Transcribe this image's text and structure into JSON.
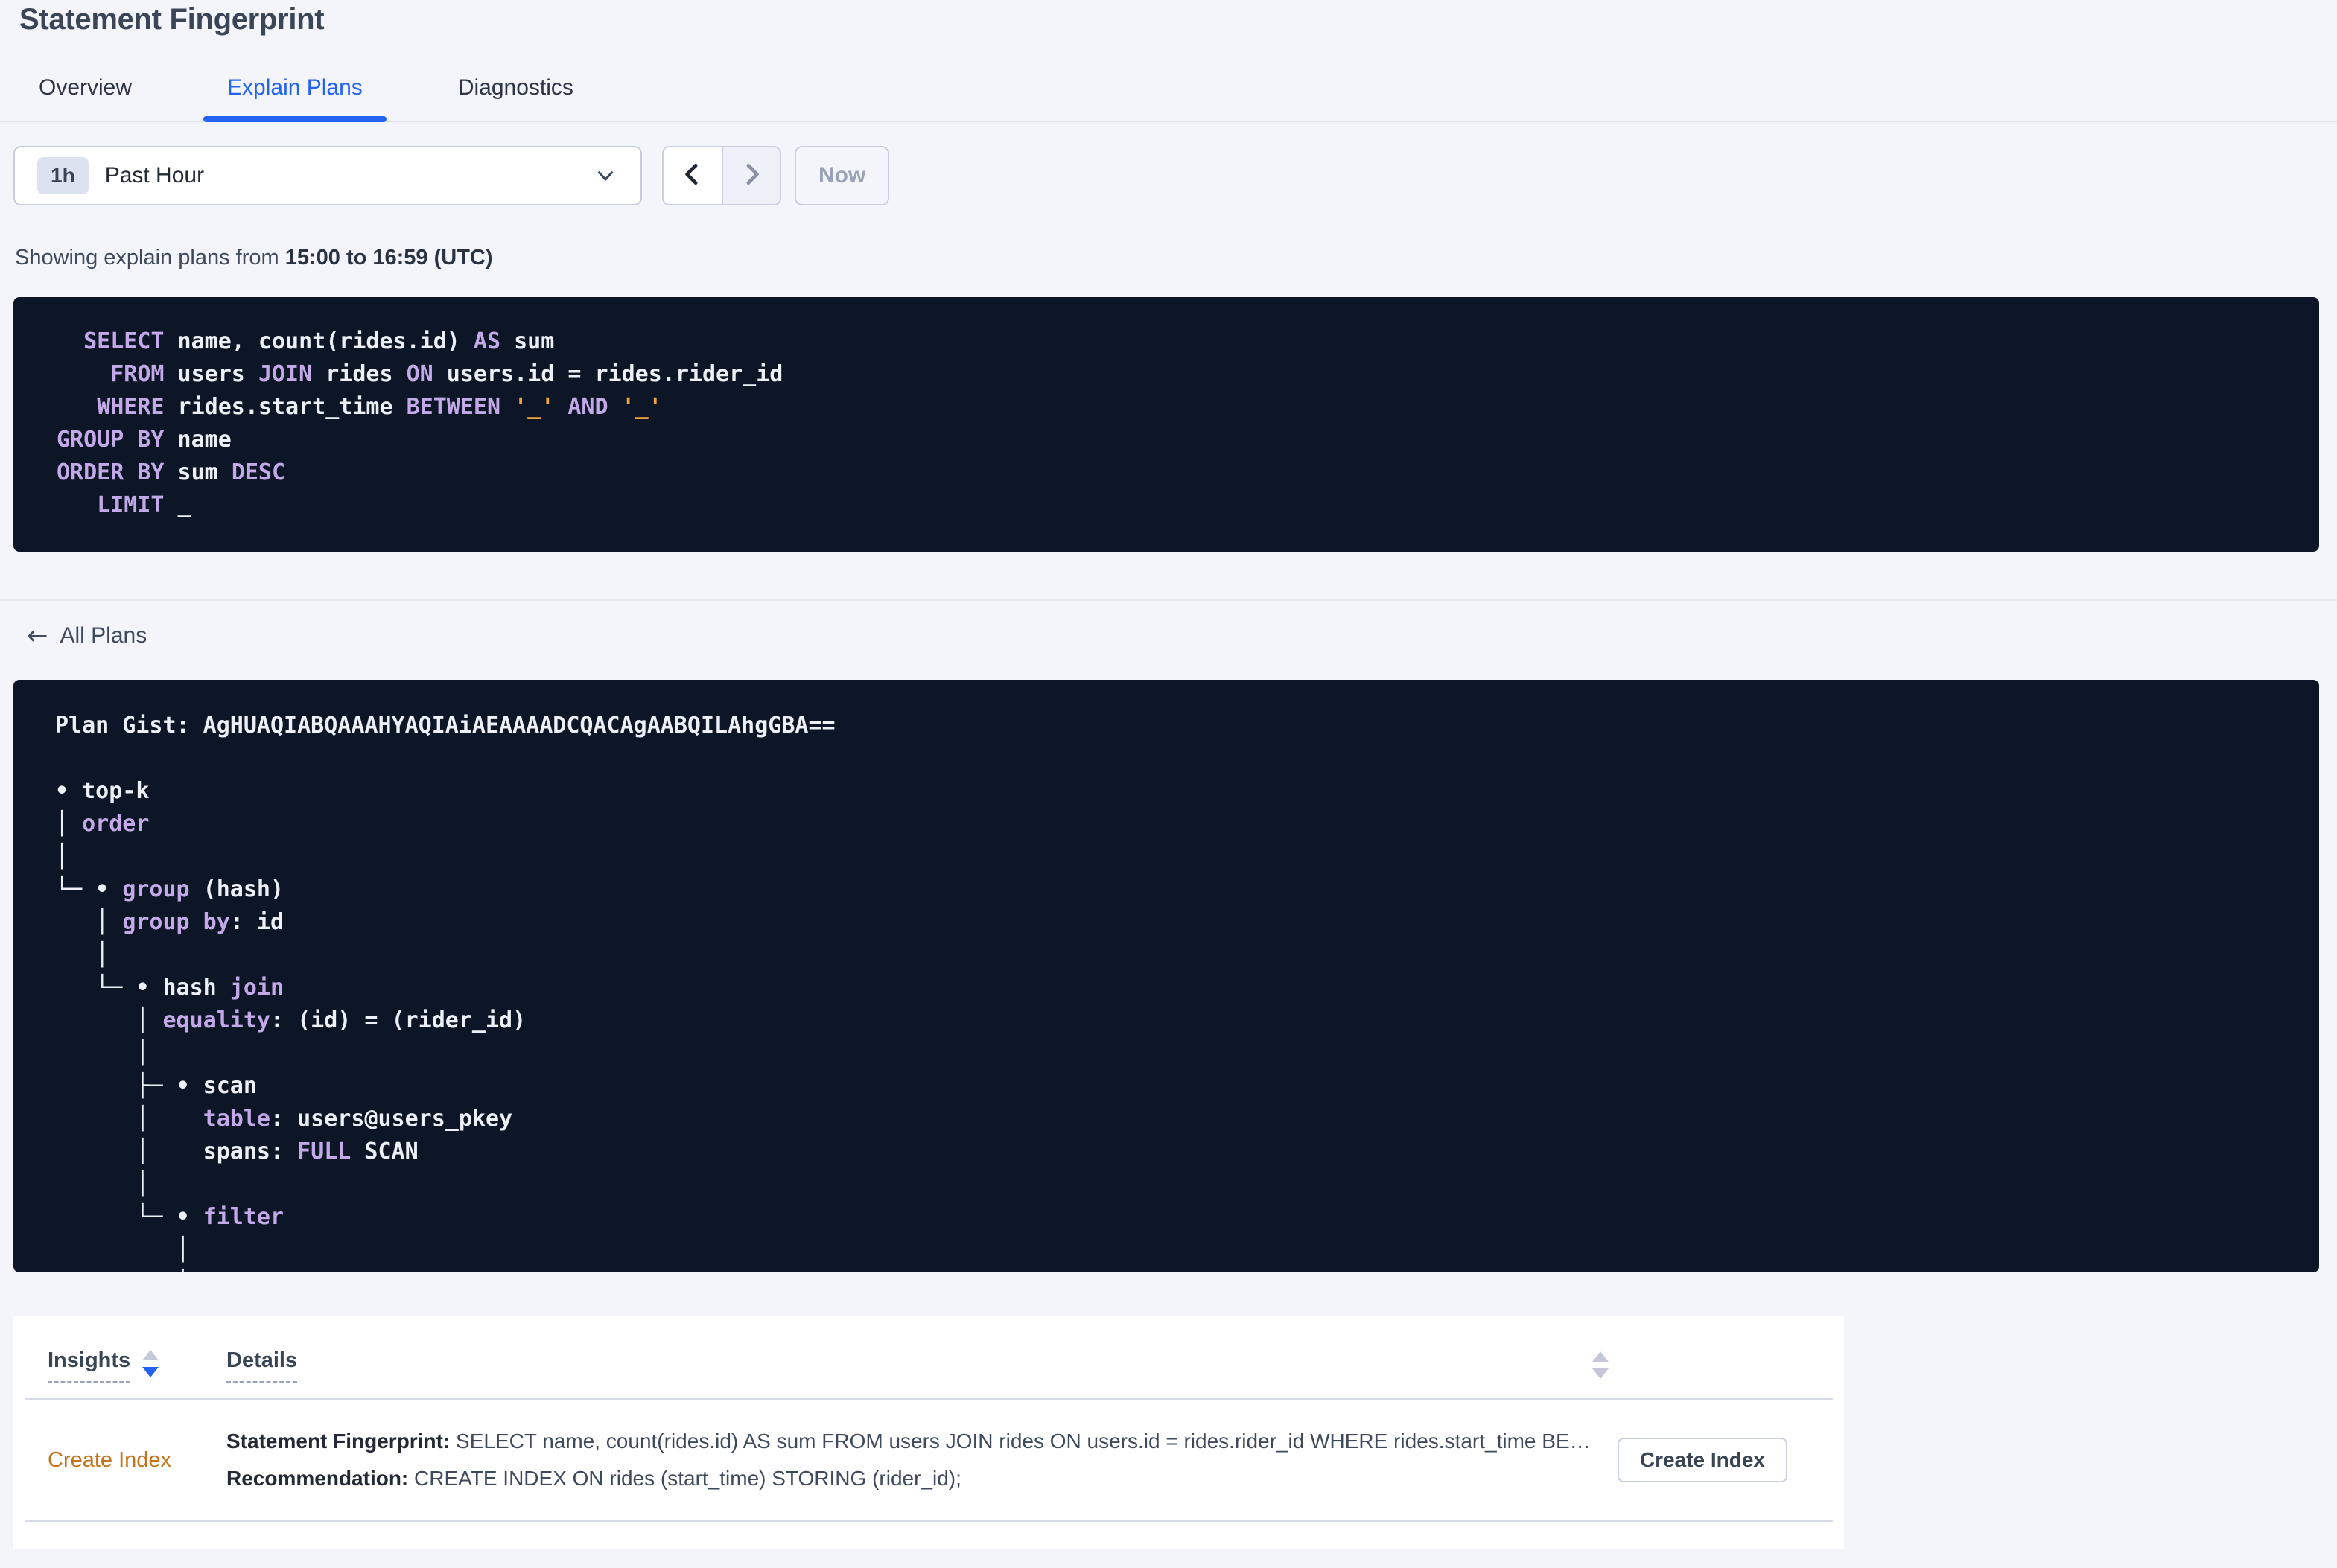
{
  "page": {
    "title": "Statement Fingerprint"
  },
  "tabs": [
    {
      "label": "Overview",
      "active": false
    },
    {
      "label": "Explain Plans",
      "active": true
    },
    {
      "label": "Diagnostics",
      "active": false
    }
  ],
  "time_picker": {
    "badge": "1h",
    "label": "Past Hour"
  },
  "nav": {
    "now_label": "Now"
  },
  "showing": {
    "prefix": "Showing explain plans from ",
    "range": "15:00 to 16:59 (UTC)"
  },
  "back_link": {
    "label": "All Plans"
  },
  "colors": {
    "accent_blue": "#2363F1",
    "code_background": "#0D1626",
    "code_keyword": "#C4A9E8",
    "code_placeholder": "#F0A43E",
    "insight_orange": "#C4731A"
  },
  "sql": {
    "lines": [
      [
        [
          "fg",
          "  "
        ],
        [
          "kw",
          "SELECT"
        ],
        [
          "fg",
          " name, count(rides.id) "
        ],
        [
          "kw",
          "AS"
        ],
        [
          "fg",
          " sum"
        ]
      ],
      [
        [
          "fg",
          "    "
        ],
        [
          "kw",
          "FROM"
        ],
        [
          "fg",
          " users "
        ],
        [
          "kw",
          "JOIN"
        ],
        [
          "fg",
          " rides "
        ],
        [
          "kw",
          "ON"
        ],
        [
          "fg",
          " users.id = rides.rider_id"
        ]
      ],
      [
        [
          "fg",
          "   "
        ],
        [
          "kw",
          "WHERE"
        ],
        [
          "fg",
          " rides.start_time "
        ],
        [
          "kw",
          "BETWEEN"
        ],
        [
          "fg",
          " "
        ],
        [
          "or",
          "'_'"
        ],
        [
          "fg",
          " "
        ],
        [
          "kw",
          "AND"
        ],
        [
          "fg",
          " "
        ],
        [
          "or",
          "'_'"
        ]
      ],
      [
        [
          "kw",
          "GROUP BY"
        ],
        [
          "fg",
          " name"
        ]
      ],
      [
        [
          "kw",
          "ORDER BY"
        ],
        [
          "fg",
          " sum "
        ],
        [
          "kw",
          "DESC"
        ]
      ],
      [
        [
          "fg",
          "   "
        ],
        [
          "kw",
          "LIMIT"
        ],
        [
          "fg",
          " _"
        ]
      ]
    ]
  },
  "plan": {
    "gist": "Plan Gist: AgHUAQIABQAAAHYAQIAiAEAAAADCQACAgAABQILAhgGBA==",
    "lines": [
      [
        [
          "fg",
          "Plan Gist: AgHUAQIABQAAAHYAQIAiAEAAAADCQACAgAABQILAhgGBA=="
        ]
      ],
      [],
      [
        [
          "fg",
          "• top-k"
        ]
      ],
      [
        [
          "fg",
          "│ "
        ],
        [
          "kw",
          "order"
        ]
      ],
      [
        [
          "fg",
          "│"
        ]
      ],
      [
        [
          "fg",
          "└─ • "
        ],
        [
          "kw",
          "group"
        ],
        [
          "fg",
          " (hash)"
        ]
      ],
      [
        [
          "fg",
          "   │ "
        ],
        [
          "kw",
          "group by"
        ],
        [
          "fg",
          ": id"
        ]
      ],
      [
        [
          "fg",
          "   │"
        ]
      ],
      [
        [
          "fg",
          "   └─ • hash "
        ],
        [
          "kw",
          "join"
        ]
      ],
      [
        [
          "fg",
          "      │ "
        ],
        [
          "kw",
          "equality"
        ],
        [
          "fg",
          ": (id) = (rider_id)"
        ]
      ],
      [
        [
          "fg",
          "      │"
        ]
      ],
      [
        [
          "fg",
          "      ├─ • scan"
        ]
      ],
      [
        [
          "fg",
          "      │    "
        ],
        [
          "kw",
          "table"
        ],
        [
          "fg",
          ": users@users_pkey"
        ]
      ],
      [
        [
          "fg",
          "      │    spans: "
        ],
        [
          "kw",
          "FULL"
        ],
        [
          "fg",
          " SCAN"
        ]
      ],
      [
        [
          "fg",
          "      │"
        ]
      ],
      [
        [
          "fg",
          "      └─ • "
        ],
        [
          "kw",
          "filter"
        ]
      ],
      [
        [
          "fg",
          "         │"
        ]
      ],
      [
        [
          "fg",
          "         │"
        ]
      ]
    ]
  },
  "insights_table": {
    "headers": [
      {
        "label": "Insights",
        "sort": "desc"
      },
      {
        "label": "Details",
        "sort": "none"
      }
    ],
    "rows": [
      {
        "insight": "Create Index",
        "details": [
          {
            "label": "Statement Fingerprint:",
            "text": " SELECT name, count(rides.id) AS sum FROM users JOIN rides ON users.id = rides.rider_id WHERE rides.start_time BETWEEN '_' AND '_' GROUP BY name ORDER BY sum DESC LIMIT _"
          },
          {
            "label": "Recommendation:",
            "text": " CREATE INDEX ON rides (start_time) STORING (rider_id);"
          }
        ],
        "action_label": "Create Index"
      }
    ]
  }
}
